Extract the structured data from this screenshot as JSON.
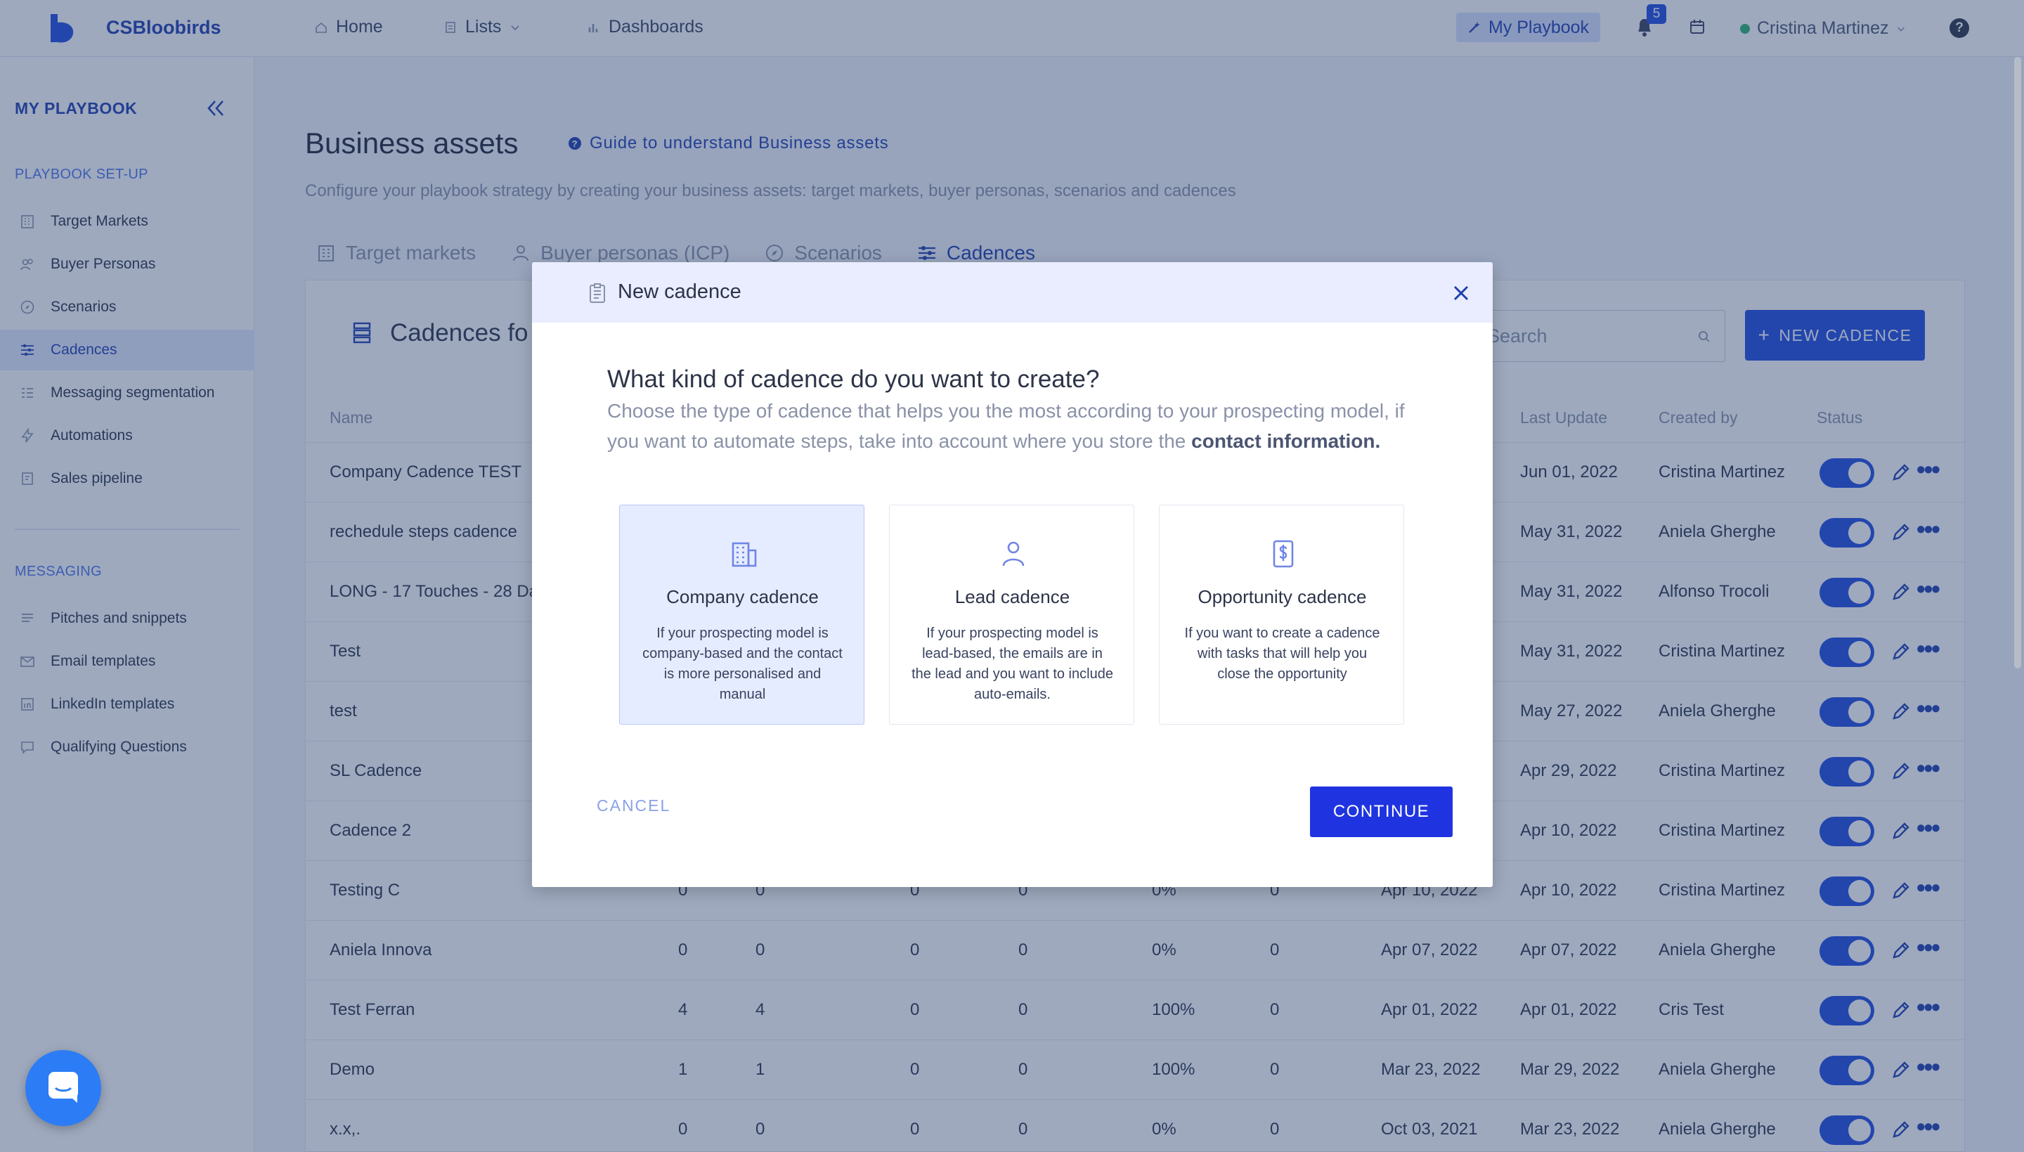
{
  "app": {
    "brand": "CSBloobirds"
  },
  "topnav": {
    "home": "Home",
    "lists": "Lists",
    "dashboards": "Dashboards",
    "my_playbook": "My Playbook",
    "notifications_count": "5",
    "user_name": "Cristina Martinez",
    "help": "?"
  },
  "sidebar": {
    "title": "MY PLAYBOOK",
    "setup_section": "PLAYBOOK SET-UP",
    "setup_items": [
      {
        "label": "Target Markets",
        "icon": "building-icon"
      },
      {
        "label": "Buyer Personas",
        "icon": "people-icon"
      },
      {
        "label": "Scenarios",
        "icon": "compass-icon"
      },
      {
        "label": "Cadences",
        "icon": "cadence-icon",
        "active": true
      },
      {
        "label": "Messaging segmentation",
        "icon": "grid-icon"
      },
      {
        "label": "Automations",
        "icon": "bolt-icon"
      },
      {
        "label": "Sales pipeline",
        "icon": "pipeline-icon"
      }
    ],
    "messaging_section": "MESSAGING",
    "messaging_items": [
      {
        "label": "Pitches and snippets",
        "icon": "lines-icon"
      },
      {
        "label": "Email templates",
        "icon": "mail-icon"
      },
      {
        "label": "LinkedIn templates",
        "icon": "linkedin-icon"
      },
      {
        "label": "Qualifying Questions",
        "icon": "chat-icon"
      }
    ]
  },
  "main": {
    "title": "Business assets",
    "guide": "Guide to understand Business assets",
    "subtitle": "Configure your playbook strategy by creating your business assets: target markets, buyer personas, scenarios and cadences",
    "tabs": [
      {
        "label": "Target markets"
      },
      {
        "label": "Buyer personas (ICP)"
      },
      {
        "label": "Scenarios"
      },
      {
        "label": "Cadences",
        "active": true
      }
    ],
    "card_title": "Cadences fo",
    "search_placeholder": "Search",
    "new_button": "NEW CADENCE",
    "columns": {
      "name": "Name",
      "last_update": "Last Update",
      "created_by": "Created by",
      "status": "Status"
    },
    "rows": [
      {
        "name": "Company Cadence TEST",
        "c1": "",
        "c2": "",
        "c3": "",
        "c4": "",
        "c5": "",
        "c6": "",
        "created": "",
        "updated": "Jun 01, 2022",
        "by": "Cristina Martinez"
      },
      {
        "name": "rechedule steps cadence",
        "c1": "",
        "c2": "",
        "c3": "",
        "c4": "",
        "c5": "",
        "c6": "",
        "created": "",
        "updated": "May 31, 2022",
        "by": "Aniela Gherghe"
      },
      {
        "name": "LONG - 17 Touches - 28 Da",
        "c1": "",
        "c2": "",
        "c3": "",
        "c4": "",
        "c5": "",
        "c6": "",
        "created": "",
        "updated": "May 31, 2022",
        "by": "Alfonso Trocoli"
      },
      {
        "name": "Test",
        "c1": "",
        "c2": "",
        "c3": "",
        "c4": "",
        "c5": "",
        "c6": "",
        "created": "",
        "updated": "May 31, 2022",
        "by": "Cristina Martinez"
      },
      {
        "name": "test",
        "c1": "",
        "c2": "",
        "c3": "",
        "c4": "",
        "c5": "",
        "c6": "",
        "created": "",
        "updated": "May 27, 2022",
        "by": "Aniela Gherghe"
      },
      {
        "name": "SL Cadence",
        "c1": "",
        "c2": "",
        "c3": "",
        "c4": "",
        "c5": "",
        "c6": "",
        "created": "",
        "updated": "Apr 29, 2022",
        "by": "Cristina Martinez"
      },
      {
        "name": "Cadence 2",
        "c1": "",
        "c2": "",
        "c3": "",
        "c4": "",
        "c5": "",
        "c6": "",
        "created": "",
        "updated": "Apr 10, 2022",
        "by": "Cristina Martinez"
      },
      {
        "name": "Testing C",
        "c1": "0",
        "c2": "0",
        "c3": "0",
        "c4": "0",
        "c5": "0%",
        "c6": "0",
        "created": "Apr 10, 2022",
        "updated": "Apr 10, 2022",
        "by": "Cristina Martinez"
      },
      {
        "name": "Aniela Innova",
        "c1": "0",
        "c2": "0",
        "c3": "0",
        "c4": "0",
        "c5": "0%",
        "c6": "0",
        "created": "Apr 07, 2022",
        "updated": "Apr 07, 2022",
        "by": "Aniela Gherghe"
      },
      {
        "name": "Test Ferran",
        "c1": "4",
        "c2": "4",
        "c3": "0",
        "c4": "0",
        "c5": "100%",
        "c6": "0",
        "created": "Apr 01, 2022",
        "updated": "Apr 01, 2022",
        "by": "Cris Test"
      },
      {
        "name": "Demo",
        "c1": "1",
        "c2": "1",
        "c3": "0",
        "c4": "0",
        "c5": "100%",
        "c6": "0",
        "created": "Mar 23, 2022",
        "updated": "Mar 29, 2022",
        "by": "Aniela Gherghe"
      },
      {
        "name": "x.x,.",
        "c1": "0",
        "c2": "0",
        "c3": "0",
        "c4": "0",
        "c5": "0%",
        "c6": "0",
        "created": "Oct 03, 2021",
        "updated": "Mar 23, 2022",
        "by": "Aniela Gherghe"
      }
    ]
  },
  "modal": {
    "title": "New cadence",
    "question": "What kind of cadence do you want to create?",
    "description": "Choose the type of cadence that helps you the most according to your prospecting model, if you want to automate steps, take into account where you store the",
    "description_bold": "contact information.",
    "options": [
      {
        "title": "Company cadence",
        "description": "If your prospecting model is company-based and the contact is more personalised and manual",
        "icon": "building-icon",
        "selected": true
      },
      {
        "title": "Lead cadence",
        "description": "If your prospecting model is lead-based, the emails are in the lead and you want to include auto-emails.",
        "icon": "person-icon"
      },
      {
        "title": "Opportunity cadence",
        "description": "If you want to create a cadence with tasks that will help you close the opportunity",
        "icon": "dollar-doc-icon"
      }
    ],
    "cancel": "CANCEL",
    "continue": "CONTINUE"
  },
  "colors": {
    "accent": "#1f4be0",
    "brand": "#1f3fb0",
    "overlay": "#28406e"
  }
}
